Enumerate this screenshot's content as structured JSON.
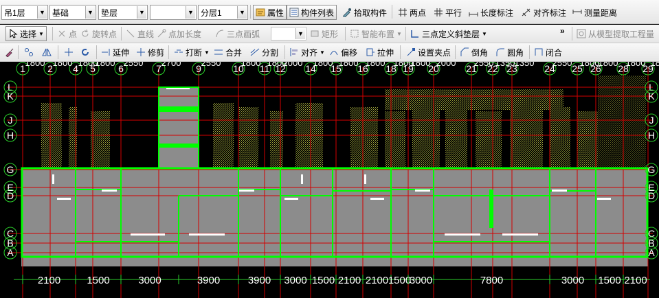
{
  "toolbar1": {
    "floor_select": "吊1层",
    "type_select": "基础",
    "component_select": "垫层",
    "item_select": "",
    "sublayer_select": "分层1",
    "property_label": "属性",
    "component_list_label": "构件列表",
    "pick_component_label": "拾取构件",
    "two_points_label": "两点",
    "parallel_label": "平行",
    "length_dim_label": "长度标注",
    "aligned_dim_label": "对齐标注",
    "measure_distance_label": "测量距离"
  },
  "toolbar2": {
    "select_label": "选择",
    "point_label": "点",
    "rotate_point_label": "旋转点",
    "line_label": "直线",
    "point_add_length_label": "点加长度",
    "three_point_arc_label": "三点画弧",
    "rectangle_label": "矩形",
    "smart_layout_label": "智能布置",
    "three_point_slope_label": "三点定义斜垫层",
    "extract_from_model_label": "从模型提取工程量",
    "more_glyph": "»"
  },
  "toolbar3": {
    "extend_label": "延伸",
    "trim_label": "修剪",
    "break_label": "打断",
    "merge_label": "合并",
    "split_label": "分割",
    "align_label": "对齐",
    "offset_label": "偏移",
    "stretch_label": "拉伸",
    "set_grip_label": "设置夹点",
    "chamfer_label": "倒角",
    "fillet_label": "圆角",
    "close_label": "闭合"
  },
  "drawing": {
    "top_axis_labels": [
      "1",
      "2",
      "4",
      "5",
      "6",
      "7",
      "9",
      "10",
      "11",
      "12",
      "14",
      "15",
      "16",
      "18",
      "19",
      "20",
      "21",
      "22",
      "23",
      "24",
      "25",
      "26",
      "28",
      "29"
    ],
    "top_dims": [
      "1800",
      "1800",
      "1800",
      "1800",
      "2550",
      "2700",
      "2550",
      "1800",
      "1800",
      "2000",
      "1800",
      "1800",
      "1800",
      "1800",
      "1800",
      "2000",
      "2550",
      "1350",
      "1350",
      "2550",
      "1800",
      "1800",
      "1800",
      "1800"
    ],
    "left_axis_labels": [
      "L",
      "K",
      "J",
      "H",
      "G",
      "E",
      "D",
      "C",
      "B",
      "A"
    ],
    "right_axis_labels": [
      "L",
      "K",
      "J",
      "H",
      "G",
      "E",
      "D",
      "C",
      "B",
      "A"
    ],
    "bottom_dims": [
      "2100",
      "1500",
      "3000",
      "3900",
      "3900",
      "3000",
      "1500",
      "2100",
      "2100",
      "1500",
      "3000",
      "7800",
      "3000",
      "1500",
      "2100"
    ]
  },
  "colors": {
    "canvas_bg": "#000000",
    "axis_line": "#d40000",
    "axis_circle": "#2bd12b",
    "wall_green": "#00ff00",
    "slab_gray": "#8c8c8c",
    "hatch_yellow": "#9ea23a",
    "dim_text": "#ffffff"
  }
}
